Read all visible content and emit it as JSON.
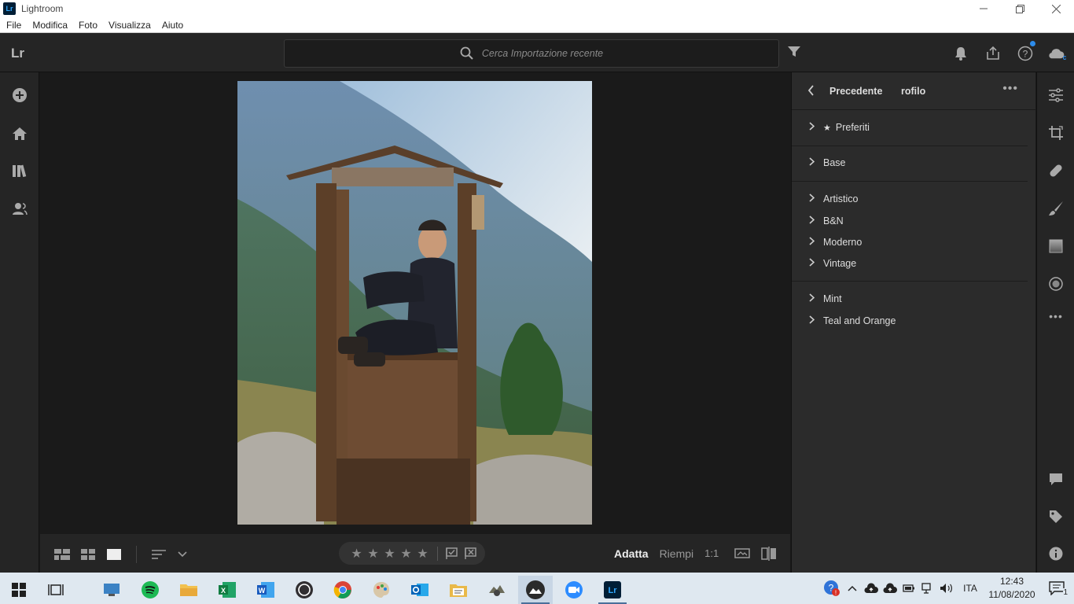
{
  "window": {
    "app_icon": "Lr",
    "title": "Lightroom",
    "minimize_icon": "minimize-icon",
    "maximize_icon": "restore-icon",
    "close_icon": "close-icon"
  },
  "menu": [
    "File",
    "Modifica",
    "Foto",
    "Visualizza",
    "Aiuto"
  ],
  "topbar": {
    "logo": "Lr",
    "search_placeholder": "Cerca Importazione recente",
    "accent": "#2d8ceb"
  },
  "left_rail": {
    "icons": [
      "add-icon",
      "home-icon",
      "library-icon",
      "people-icon"
    ]
  },
  "bottom_bar": {
    "view_icons": [
      "square-grid-icon",
      "grid-icon",
      "detail-view-icon",
      "sort-icon",
      "chevron-down-icon"
    ],
    "rating_stars": 5,
    "rating_value": 0,
    "flags": [
      "pick-flag-icon",
      "reject-flag-icon"
    ],
    "zoom_fit": "Adatta",
    "zoom_fill": "Riempi",
    "zoom_1to1": "1:1"
  },
  "right_panel": {
    "back_label": "Precedente",
    "title": "rofilo",
    "groups": [
      {
        "items": [
          {
            "label": "Preferiti",
            "starred": true
          }
        ]
      },
      {
        "items": [
          {
            "label": "Base"
          }
        ]
      },
      {
        "items": [
          {
            "label": "Artistico"
          },
          {
            "label": "B&N"
          },
          {
            "label": "Moderno"
          },
          {
            "label": "Vintage"
          }
        ]
      },
      {
        "items": [
          {
            "label": "Mint"
          },
          {
            "label": "Teal and Orange"
          }
        ]
      }
    ]
  },
  "right_rail": {
    "icons": [
      "edit-sliders-icon",
      "crop-icon",
      "healing-icon",
      "brush-icon",
      "linear-gradient-icon",
      "radial-gradient-icon",
      "more-icon",
      "comment-icon",
      "keyword-tag-icon",
      "info-icon"
    ]
  },
  "taskbar": {
    "apps": [
      "start-icon",
      "task-view-icon",
      "explorer-remote-icon",
      "spotify-icon",
      "file-explorer-icon",
      "excel-icon",
      "word-icon",
      "obs-icon",
      "chrome-icon",
      "paint-icon",
      "outlook-icon",
      "folder-icon",
      "app-icon",
      "photos-icon",
      "zoom-icon",
      "lightroom-icon"
    ],
    "active_app": "lightroom-icon",
    "language": "ITA",
    "time": "12:43",
    "date": "11/08/2020",
    "notification_count": "1"
  }
}
